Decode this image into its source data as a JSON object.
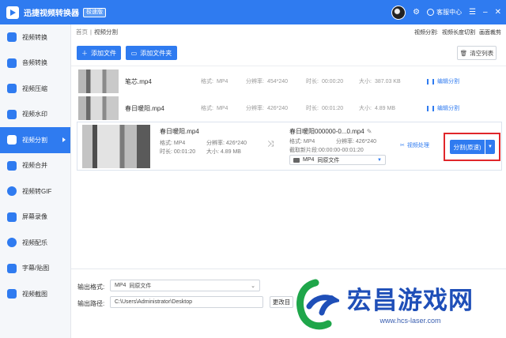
{
  "app": {
    "title": "迅捷视频转换器",
    "badge": "极速版",
    "customer_service": "客服中心"
  },
  "sidebar": {
    "items": [
      {
        "label": "视频转换",
        "icon": "video-convert-icon"
      },
      {
        "label": "音频转换",
        "icon": "audio-convert-icon"
      },
      {
        "label": "视频压缩",
        "icon": "video-compress-icon"
      },
      {
        "label": "视频水印",
        "icon": "video-watermark-icon"
      },
      {
        "label": "视频分割",
        "icon": "video-split-icon",
        "active": true
      },
      {
        "label": "视频合并",
        "icon": "video-merge-icon"
      },
      {
        "label": "视频转GIF",
        "icon": "video-gif-icon"
      },
      {
        "label": "屏幕录像",
        "icon": "screen-record-icon"
      },
      {
        "label": "视频配乐",
        "icon": "video-music-icon"
      },
      {
        "label": "字幕/贴图",
        "icon": "subtitle-icon"
      },
      {
        "label": "视频截图",
        "icon": "video-screenshot-icon"
      }
    ]
  },
  "breadcrumb": {
    "home": "首页",
    "current": "视频分割",
    "right_label": "视频分割:",
    "right_option1": "视频长度切割",
    "right_option2": "画面裁剪"
  },
  "toolbar": {
    "add_file": "添加文件",
    "add_folder": "添加文件夹",
    "clear_list": "清空列表"
  },
  "files": [
    {
      "name": "笔芯.mp4",
      "format_label": "格式:",
      "format": "MP4",
      "res_label": "分辨率:",
      "res": "454*240",
      "dur_label": "时长:",
      "duration": "00:00:20",
      "size_label": "大小:",
      "size": "387.03 KB",
      "action": "编辑分割"
    },
    {
      "name": "春日暖阳.mp4",
      "format_label": "格式:",
      "format": "MP4",
      "res_label": "分辨率:",
      "res": "426*240",
      "dur_label": "时长:",
      "duration": "00:01:20",
      "size_label": "大小:",
      "size": "4.89 MB",
      "action": "编辑分割"
    }
  ],
  "expanded": {
    "name": "春日暖阳.mp4",
    "format_label": "格式:",
    "format": "MP4",
    "res_label": "分辨率:",
    "res": "426*240",
    "dur_label": "时长:",
    "duration": "00:01:20",
    "size_label": "大小:",
    "size": "4.89 MB",
    "out_name": "春日暖阳000000-0...0.mp4",
    "out_format_label": "格式:",
    "out_format": "MP4",
    "out_res_label": "分辨率:",
    "out_res": "426*240",
    "clip_label": "截取新片段:",
    "clip": "00:00:00-00:01:20",
    "select_format": "MP4",
    "select_quality": "同原文件",
    "video_process": "视频处理",
    "split_button": "分割(原速)"
  },
  "output": {
    "format_label": "输出格式:",
    "format_value": "MP4",
    "format_quality": "同原文件",
    "path_label": "输出路径:",
    "path_value": "C:\\Users\\Administrator\\Desktop",
    "change_button": "更改目"
  },
  "watermark": {
    "title": "宏昌游戏网",
    "url": "www.hcs-laser.com"
  },
  "colors": {
    "primary": "#2f7bf0",
    "highlight": "#e0262a",
    "watermark": "#1f4fb8"
  }
}
